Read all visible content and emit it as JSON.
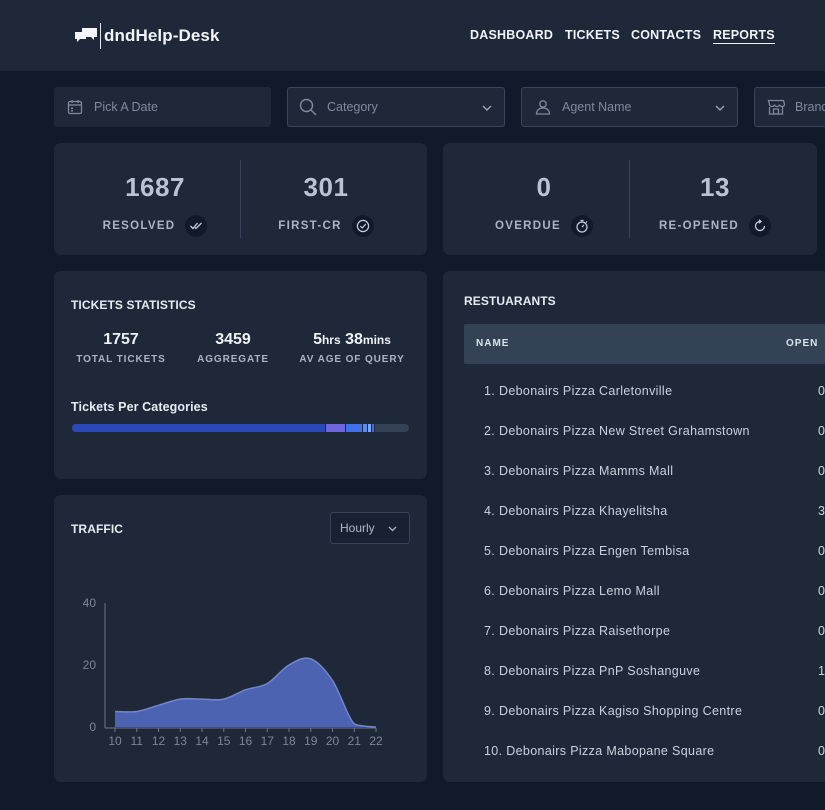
{
  "app": {
    "name": "dndHelp-Desk"
  },
  "nav": [
    "DASHBOARD",
    "TICKETS",
    "CONTACTS",
    "REPORTS"
  ],
  "nav_active": "REPORTS",
  "filters": {
    "date": {
      "placeholder": "Pick A Date",
      "icon": "calendar-icon"
    },
    "category": {
      "value": "Category",
      "icon": "search-icon"
    },
    "agent": {
      "value": "Agent Name",
      "icon": "user-icon"
    },
    "brand": {
      "value": "Brand",
      "icon": "store-icon"
    }
  },
  "kpis": [
    {
      "value": "1687",
      "label": "RESOLVED",
      "icon": "double-check-icon"
    },
    {
      "value": "301",
      "label": "FIRST-CR",
      "icon": "check-circle-icon"
    },
    {
      "value": "0",
      "label": "OVERDUE",
      "icon": "stopwatch-icon"
    },
    {
      "value": "13",
      "label": "RE-OPENED",
      "icon": "refresh-icon"
    }
  ],
  "tickets_statistics": {
    "title": "TICKETS STATISTICS",
    "total_tickets": {
      "value": "1757",
      "label": "TOTAL TICKETS"
    },
    "aggregate": {
      "value": "3459",
      "label": "AGGREGATE"
    },
    "av_age": {
      "hours": "5",
      "hours_unit": "hrs",
      "minutes": "38",
      "minutes_unit": "mins",
      "label": "AV AGE OF QUERY"
    },
    "categories_title": "Tickets Per Categories",
    "category_segments": [
      {
        "share": 0.75,
        "color": "#2a49b8"
      },
      {
        "share": 0.06,
        "color": "#6d66de"
      },
      {
        "share": 0.05,
        "color": "#3f72e6"
      },
      {
        "share": 0.015,
        "color": "#5c8cf0"
      },
      {
        "share": 0.012,
        "color": "#7fa6f5"
      },
      {
        "share": 0.008,
        "color": "#4a6fd6"
      },
      {
        "share": 0.005,
        "color": "#a3b8f0"
      }
    ]
  },
  "traffic": {
    "title": "TRAFFIC",
    "interval": "Hourly"
  },
  "chart_data": {
    "type": "area",
    "x": [
      10,
      11,
      12,
      13,
      14,
      15,
      16,
      17,
      18,
      19,
      20,
      21,
      22
    ],
    "values": [
      5,
      5,
      7,
      9,
      9,
      9,
      12,
      14,
      20,
      22,
      15,
      1,
      0
    ],
    "ylim": [
      0,
      40
    ],
    "yticks": [
      0,
      20,
      40
    ],
    "xlabel": "",
    "ylabel": "",
    "color": "#4f66b8",
    "grid": false
  },
  "restaurants": {
    "title": "RESTUARANTS",
    "columns": [
      "NAME",
      "OPEN"
    ],
    "rows": [
      {
        "name": "1. Debonairs Pizza Carletonville",
        "open": "0"
      },
      {
        "name": "2. Debonairs Pizza New Street Grahamstown",
        "open": "0"
      },
      {
        "name": "3. Debonairs Pizza Mamms Mall",
        "open": "0"
      },
      {
        "name": "4. Debonairs Pizza Khayelitsha",
        "open": "3"
      },
      {
        "name": "5. Debonairs Pizza Engen Tembisa",
        "open": "0"
      },
      {
        "name": "6. Debonairs Pizza Lemo Mall",
        "open": "0"
      },
      {
        "name": "7. Debonairs Pizza Raisethorpe",
        "open": "0"
      },
      {
        "name": "8. Debonairs Pizza PnP Soshanguve",
        "open": "1"
      },
      {
        "name": "9. Debonairs Pizza Kagiso Shopping Centre",
        "open": "0"
      },
      {
        "name": "10. Debonairs Pizza Mabopane Square",
        "open": "0"
      }
    ]
  }
}
